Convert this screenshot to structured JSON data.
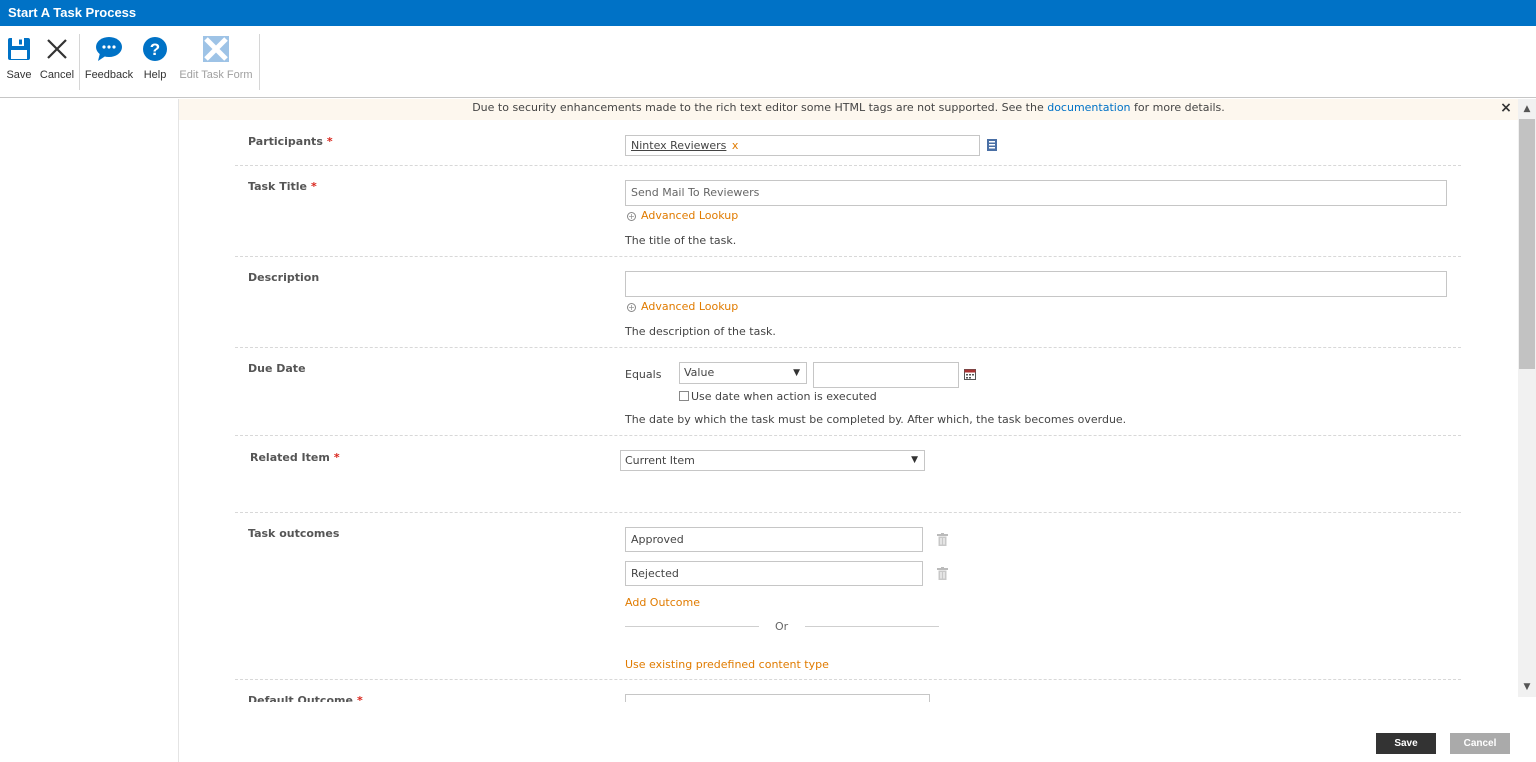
{
  "window": {
    "title": "Start A Task Process"
  },
  "ribbon": {
    "save": "Save",
    "cancel": "Cancel",
    "feedback": "Feedback",
    "help": "Help",
    "edit_task_form": "Edit Task Form"
  },
  "notice": {
    "text_before": "Due to security enhancements made to the rich text editor some HTML tags are not supported. See the ",
    "link": "documentation",
    "text_after": " for more details.",
    "close": "×"
  },
  "form": {
    "participants": {
      "label": "Participants",
      "required": "*",
      "value": "Nintex Reviewers",
      "remove": "x"
    },
    "task_title": {
      "label": "Task Title",
      "required": "*",
      "value": "Send Mail To Reviewers",
      "advanced": "Advanced Lookup",
      "help": "The title of the task."
    },
    "description": {
      "label": "Description",
      "value": "",
      "advanced": "Advanced Lookup",
      "help": "The description of the task."
    },
    "due_date": {
      "label": "Due Date",
      "equals": "Equals",
      "select": "Value",
      "value": "",
      "checkbox_label": "Use date when action is executed",
      "help": "The date by which the task must be completed by. After which, the task becomes overdue."
    },
    "related_item": {
      "label": "Related Item",
      "required": "*",
      "value": "Current Item"
    },
    "task_outcomes": {
      "label": "Task outcomes",
      "outcomes": [
        "Approved",
        "Rejected"
      ],
      "add": "Add Outcome",
      "or": "Or",
      "predefined": "Use existing predefined content type"
    },
    "default_outcome": {
      "label": "Default Outcome",
      "required": "*"
    }
  },
  "footer": {
    "save": "Save",
    "cancel": "Cancel"
  },
  "colors": {
    "accent": "#0072c6",
    "link_orange": "#e07b00",
    "required": "#d9241b"
  }
}
